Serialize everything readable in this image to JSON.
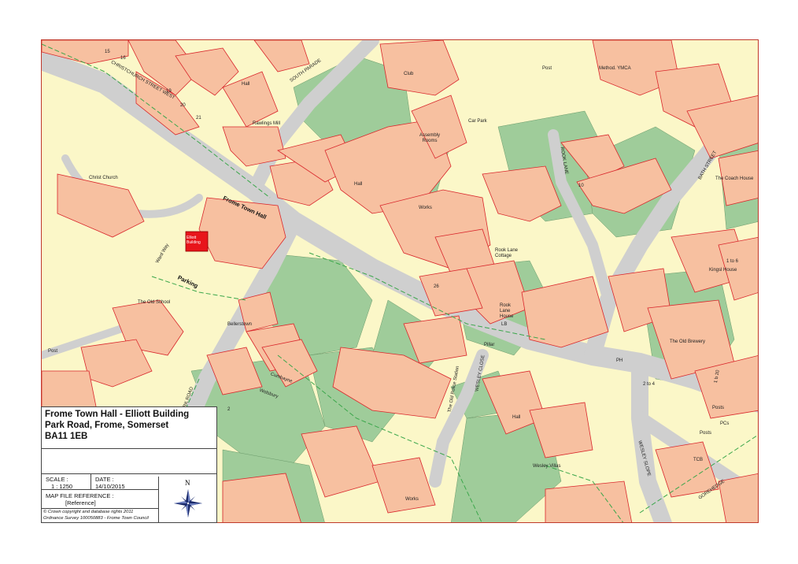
{
  "title_block": {
    "title_line1": "Frome Town Hall - Elliott Building",
    "title_line2": "Park Road, Frome, Somerset",
    "title_line3": "BA11 1EB",
    "scale_label": "SCALE :",
    "scale_value": "1 : 1250",
    "date_label": "DATE :",
    "date_value": "14/10/2015",
    "ref_label": "MAP FILE REFERENCE :",
    "ref_value": "[Reference]",
    "copyright_line1": "© Crown copyright and database rights 2011",
    "copyright_line2": "Ordnance Survey 100050883 - Frome Town Council",
    "north_label": "N"
  },
  "map": {
    "colors": {
      "building": "#f7c0a0",
      "building_outline": "#d9262b",
      "garden": "#9fcc9a",
      "land": "#fbf7c8",
      "road": "#cfcfcf",
      "highlight": "#e8151b",
      "boundary_dash": "#3aa64a"
    },
    "labels": {
      "frome_town_hall": "Frome Town Hall",
      "parking": "Parking",
      "elliott_building": "Elliott Building",
      "ward_way": "Ward Way",
      "the_old_school": "The Old School",
      "park_road": "PARK ROAD",
      "christchurch_street_west": "CHRISTCHURCH STREET WEST",
      "south_parade": "SOUTH PARADE",
      "christ_church": "Christ Church",
      "rawlings_mill": "Rawlings Mill",
      "hall_1": "Hall",
      "hall_2": "Hall",
      "hall_3": "Hall",
      "club": "Club",
      "assembly_rooms": "Assembly Rooms",
      "car_park": "Car Park",
      "works_1": "Works",
      "works_2": "Works",
      "rook_lane_cottage": "Rook Lane Cottage",
      "rook_lane_house": "Rook Lane House",
      "rook_lane": "ROOK LANE",
      "bath_street": "BATH STREET",
      "post_1": "Post",
      "post_2": "Post",
      "post_3": "Posts",
      "post_4": "Posts",
      "methodist_ymca": "Method. YMCA",
      "the_coach_house": "The Coach House",
      "kingsl_house": "Kingsl House",
      "the_old_brewery": "The Old Brewery",
      "wesley_close": "WESLEY CLOSE",
      "wesley_slope": "WESLEY SLOPE",
      "wesley_villas": "Wesley Villas",
      "gorehedge": "GOREHEDGE",
      "the_old_police_station": "The Old Police Station",
      "pillar": "Pillar",
      "bellevue": "Bellerstown",
      "cumbayne": "Cumbayne",
      "wolsbury": "Wolsbury",
      "ph": "PH",
      "tcb": "TCB",
      "pcs": "PCs",
      "lb": "LB",
      "num_26": "26",
      "num_1to6": "1 to 6",
      "num_1b20": "1 b 20",
      "num_2to4": "2 to 4",
      "num_15": "15",
      "num_16": "16",
      "num_19": "19",
      "num_20": "20",
      "num_21": "21",
      "num_2": "2",
      "num_10": "10"
    }
  }
}
